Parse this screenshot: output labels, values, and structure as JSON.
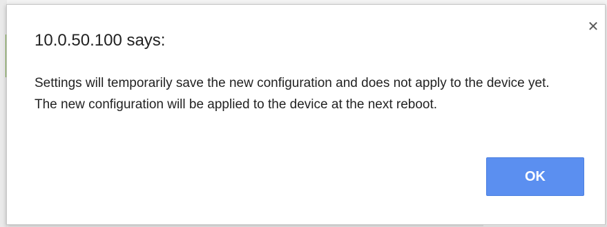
{
  "dialog": {
    "title": "10.0.50.100 says:",
    "close_symbol": "✕",
    "close_icon": "close-icon",
    "message_lines": [
      "Settings will temporarily save the new configuration and does not apply to the device yet.",
      "The new configuration will be applied to the device at the next reboot."
    ],
    "ok_label": "OK"
  },
  "colors": {
    "ok_button": "#5b8ff0",
    "dialog_background": "#ffffff",
    "text": "#222222"
  }
}
